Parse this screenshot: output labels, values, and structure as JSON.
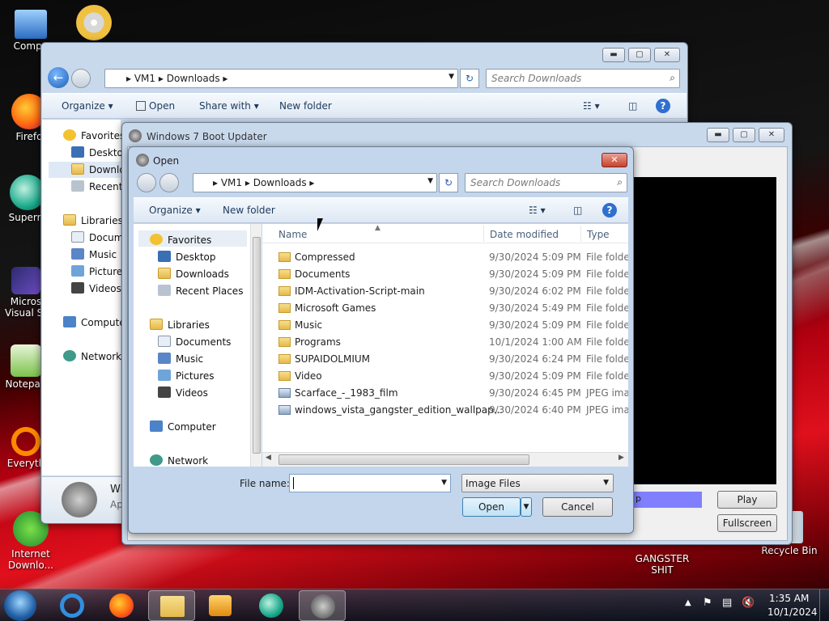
{
  "desktop": {
    "icons": [
      {
        "label": "Computer"
      },
      {
        "label": "Firefox"
      },
      {
        "label": "Supermium"
      },
      {
        "label": "Microsoft Visual Studio"
      },
      {
        "label": "Notepad++"
      },
      {
        "label": "Everything"
      },
      {
        "label": "Internet Download Manager"
      },
      {
        "label": "GANGSTER SHIT"
      },
      {
        "label": "Recycle Bin"
      }
    ],
    "icon_text": {
      "computer": "Compu",
      "firefox": "Firefo",
      "supermium": "Superm",
      "vs1": "Micros",
      "vs2": "Visual St",
      "notepad": "Notepad",
      "everything": "Everyth",
      "idm1": "Internet",
      "idm2": "Downlo...",
      "gangster1": "GANGSTER",
      "gangster2": "SHIT",
      "recycle": "Recycle Bin"
    }
  },
  "explorer": {
    "breadcrumb": [
      "VM1",
      "Downloads"
    ],
    "search_placeholder": "Search Downloads",
    "organize": "Organize",
    "share_with": "Share with",
    "new_folder": "New folder",
    "nav": {
      "favorites": "Favorites",
      "desktop": "Desktop",
      "downloads": "Downlo",
      "recent": "Recent P",
      "libraries": "Libraries",
      "documents": "Docume",
      "music": "Music",
      "pictures": "Pictures",
      "videos": "Videos",
      "computer": "Compute",
      "network": "Network"
    },
    "details_title": "Wi",
    "details_sub": "Ap"
  },
  "updater": {
    "title": "Windows 7 Boot Updater",
    "play": "Play",
    "fullscreen": "Fullscreen",
    "progress_text": "p",
    "accent": "#8080ff"
  },
  "open_dialog": {
    "title": "Open",
    "breadcrumb": [
      "VM1",
      "Downloads"
    ],
    "search_placeholder": "Search Downloads",
    "organize": "Organize",
    "new_folder": "New folder",
    "nav": {
      "favorites": "Favorites",
      "desktop": "Desktop",
      "downloads": "Downloads",
      "recent": "Recent Places",
      "libraries": "Libraries",
      "documents": "Documents",
      "music": "Music",
      "pictures": "Pictures",
      "videos": "Videos",
      "computer": "Computer",
      "network": "Network"
    },
    "columns": {
      "name": "Name",
      "date": "Date modified",
      "type": "Type"
    },
    "files": [
      {
        "name": "Compressed",
        "date": "9/30/2024 5:09 PM",
        "type": "File folder",
        "kind": "folder"
      },
      {
        "name": "Documents",
        "date": "9/30/2024 5:09 PM",
        "type": "File folder",
        "kind": "folder"
      },
      {
        "name": "IDM-Activation-Script-main",
        "date": "9/30/2024 6:02 PM",
        "type": "File folder",
        "kind": "folder"
      },
      {
        "name": "Microsoft Games",
        "date": "9/30/2024 5:49 PM",
        "type": "File folder",
        "kind": "folder"
      },
      {
        "name": "Music",
        "date": "9/30/2024 5:09 PM",
        "type": "File folder",
        "kind": "folder"
      },
      {
        "name": "Programs",
        "date": "10/1/2024 1:00 AM",
        "type": "File folder",
        "kind": "folder"
      },
      {
        "name": "SUPAIDOLMIUM",
        "date": "9/30/2024 6:24 PM",
        "type": "File folder",
        "kind": "folder"
      },
      {
        "name": "Video",
        "date": "9/30/2024 5:09 PM",
        "type": "File folder",
        "kind": "folder"
      },
      {
        "name": "Scarface_-_1983_film",
        "date": "9/30/2024 6:45 PM",
        "type": "JPEG imag",
        "kind": "image"
      },
      {
        "name": "windows_vista_gangster_edition_wallpap...",
        "date": "9/30/2024 6:40 PM",
        "type": "JPEG imag",
        "kind": "image"
      }
    ],
    "filename_label": "File name:",
    "filename_value": "",
    "filter": "Image Files",
    "open_button": "Open",
    "cancel_button": "Cancel"
  },
  "taskbar": {
    "time": "1:35 AM",
    "date": "10/1/2024"
  }
}
